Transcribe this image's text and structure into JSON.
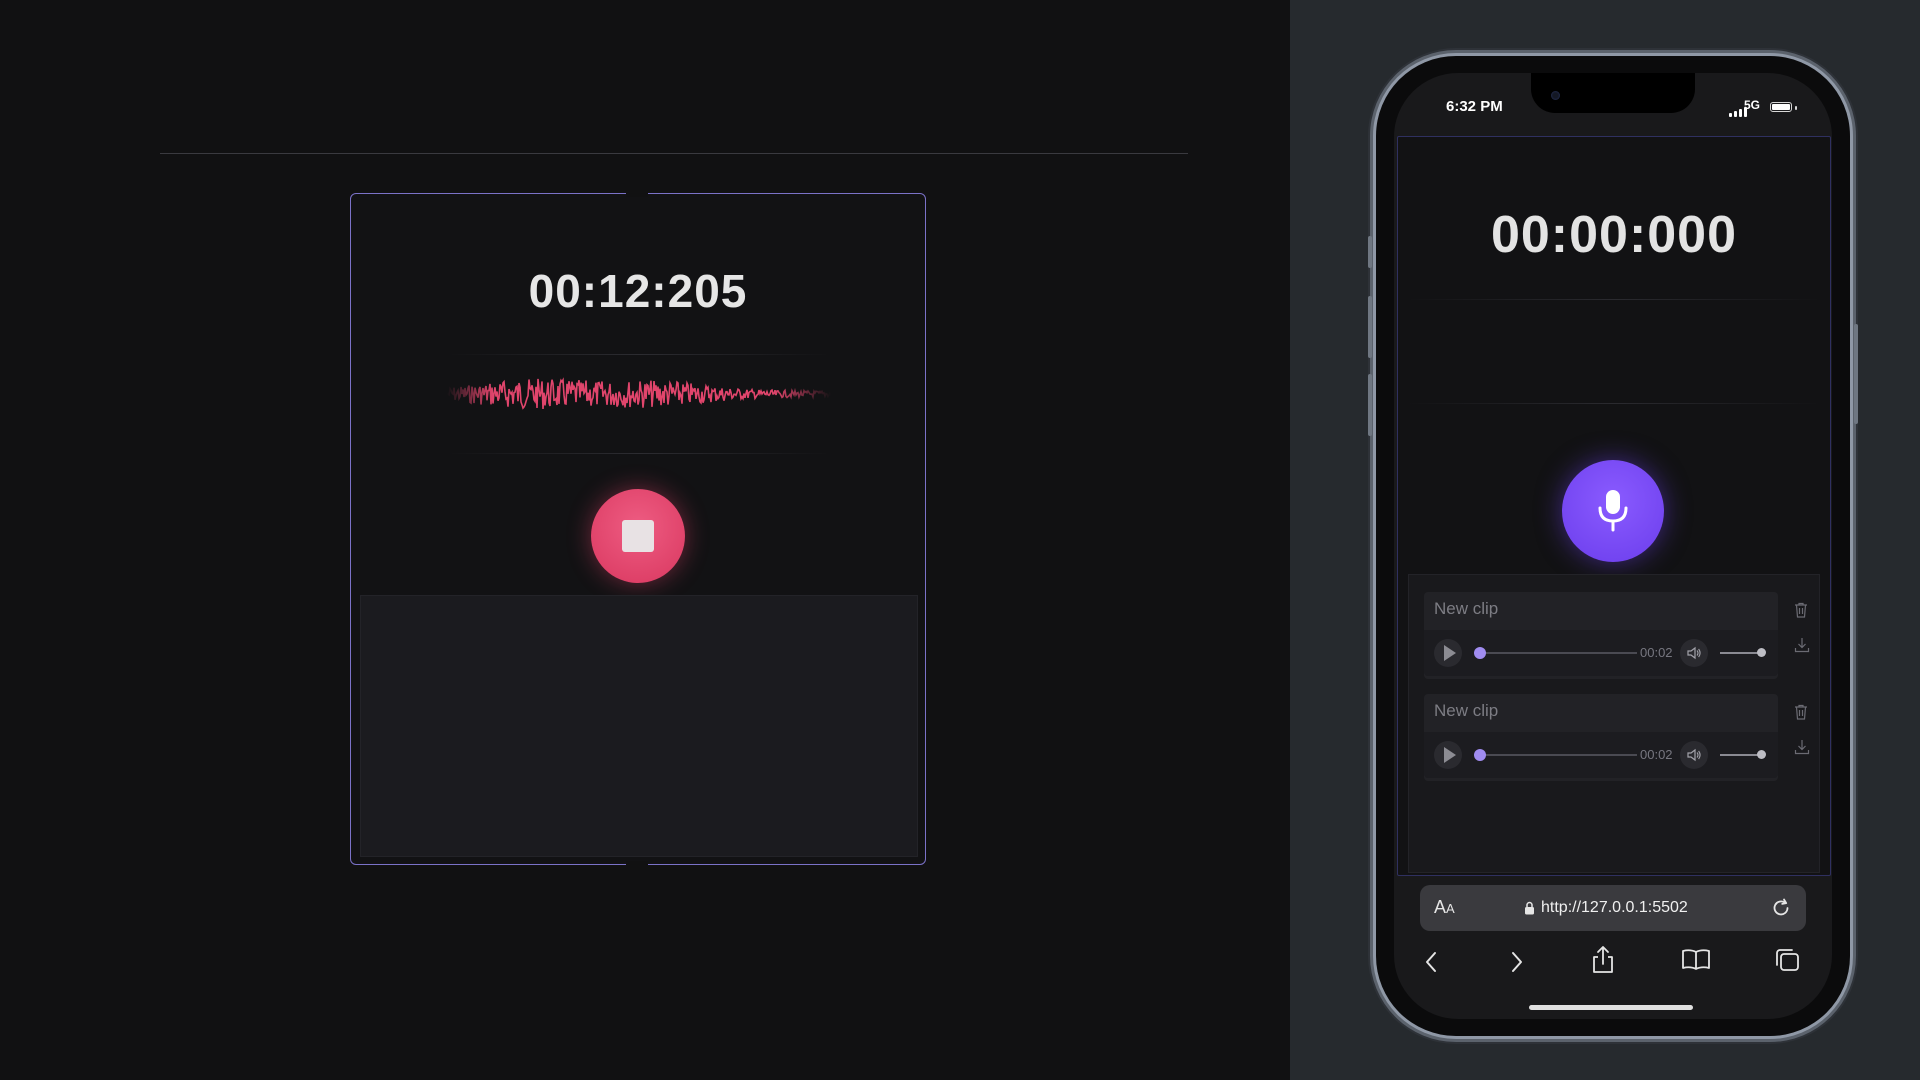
{
  "desktop": {
    "timer": "00:12:205",
    "state": "recording",
    "colors": {
      "stop_button": "#e5436b",
      "frame": "#7b72c8",
      "waveform": "#e1456c"
    },
    "icons": {
      "stop": "stop-square-icon"
    }
  },
  "mobile": {
    "status_bar": {
      "time": "6:32 PM",
      "network": "5G"
    },
    "timer": "00:00:000",
    "colors": {
      "mic_button": "#7446f5"
    },
    "icons": {
      "record": "microphone-icon",
      "delete": "trash-icon",
      "download": "download-icon"
    },
    "clips": [
      {
        "name": "New clip",
        "duration": "00:02",
        "progress": 0,
        "volume": 1
      },
      {
        "name": "New clip",
        "duration": "00:02",
        "progress": 0,
        "volume": 1
      }
    ],
    "browser": {
      "text_size_label_big": "A",
      "text_size_label_small": "A",
      "url": "http://127.0.0.1:5502"
    }
  }
}
